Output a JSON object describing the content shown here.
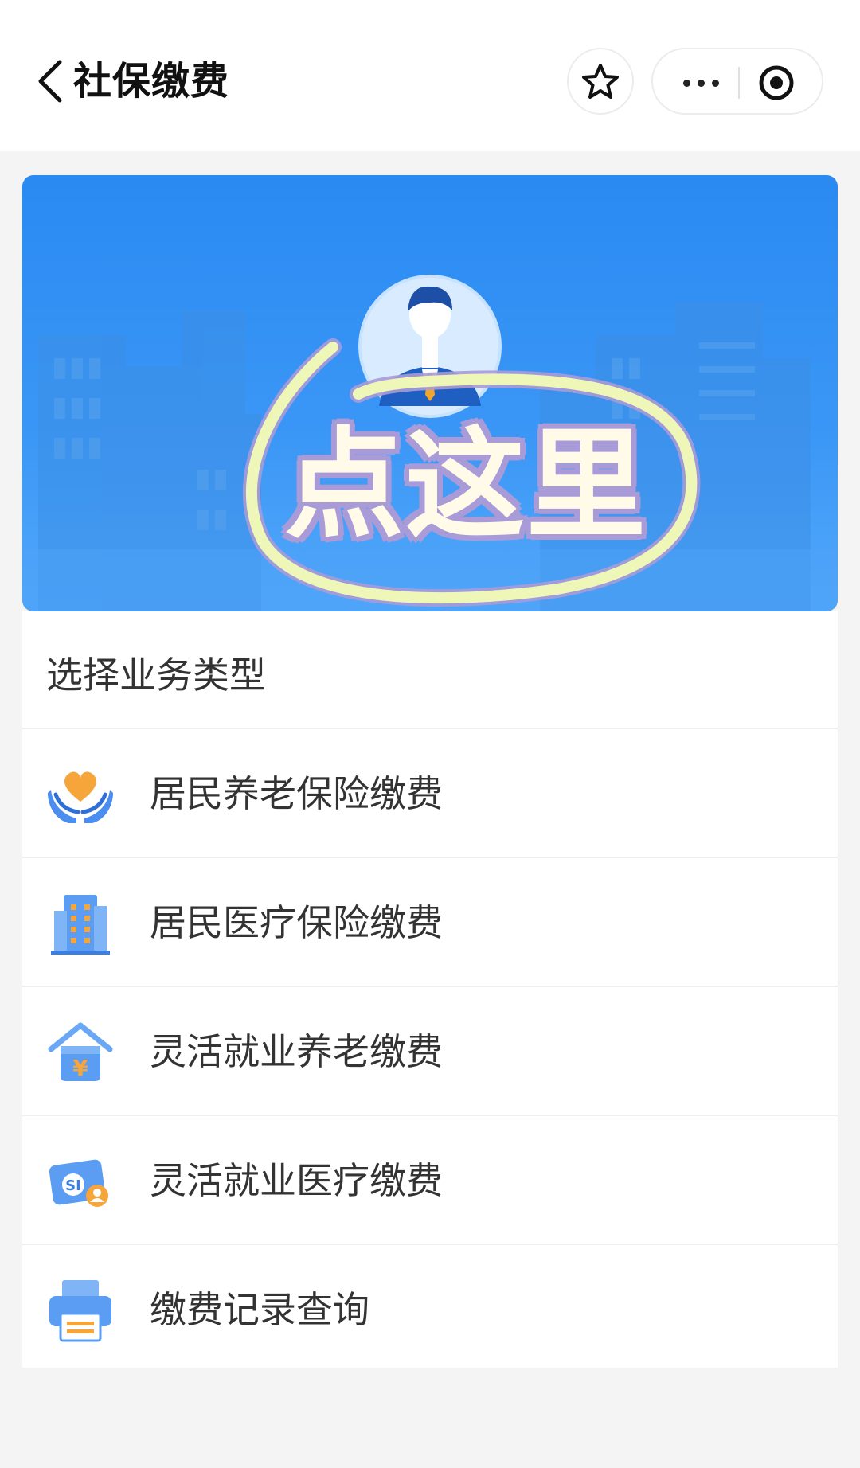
{
  "header": {
    "title": "社保缴费",
    "back_icon": "chevron-left-icon",
    "favorite_icon": "star-icon",
    "more_icon": "more-dots-icon",
    "close_icon": "target-icon"
  },
  "banner": {
    "primary_color": "#2a8af2",
    "avatar_icon": "person-avatar-icon"
  },
  "annotation": {
    "text": "点这里",
    "color": "#eef7b8"
  },
  "section": {
    "title": "选择业务类型"
  },
  "menu": {
    "items": [
      {
        "label": "居民养老保险缴费",
        "icon": "heart-hands-icon"
      },
      {
        "label": "居民医疗保险缴费",
        "icon": "building-icon"
      },
      {
        "label": "灵活就业养老缴费",
        "icon": "house-yuan-icon"
      },
      {
        "label": "灵活就业医疗缴费",
        "icon": "social-security-card-icon"
      },
      {
        "label": "缴费记录查询",
        "icon": "printer-icon"
      }
    ]
  }
}
